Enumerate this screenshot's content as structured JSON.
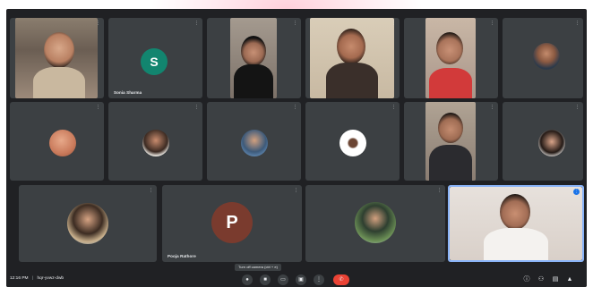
{
  "meeting": {
    "time": "12:16 PM",
    "separator": "|",
    "meeting_code": "hqr-yvwz-dwb",
    "tooltip": "Turn off camera (ctrl + e)"
  },
  "participants": [
    {
      "name": "Sonia Sharma",
      "avatar_letter": "S",
      "avatar_color": "#12856f"
    },
    {
      "name": "Pooja Rathore",
      "avatar_letter": "P",
      "avatar_color": "#7a3b2e"
    }
  ],
  "colors": {
    "background": "#202124",
    "tile": "#3c4043",
    "end_call": "#ea4335",
    "active_border": "#8ab4f8",
    "watermark": "#ffb3c6"
  },
  "icons": {
    "tile_menu": "more-options-icon",
    "mic": "microphone-icon",
    "camera": "camera-icon",
    "captions": "captions-icon",
    "present": "present-screen-icon",
    "more": "more-vert-icon",
    "end": "end-call-icon",
    "info": "info-icon",
    "people": "people-icon",
    "chat": "chat-icon",
    "activities": "activities-icon"
  },
  "glyphs": {
    "menu": "⋮",
    "mic": "●",
    "camera": "■",
    "captions": "▭",
    "present": "▣",
    "more": "⋮",
    "end": "✆",
    "info": "ⓘ",
    "people": "⚇",
    "chat": "▤",
    "activities": "▲"
  }
}
